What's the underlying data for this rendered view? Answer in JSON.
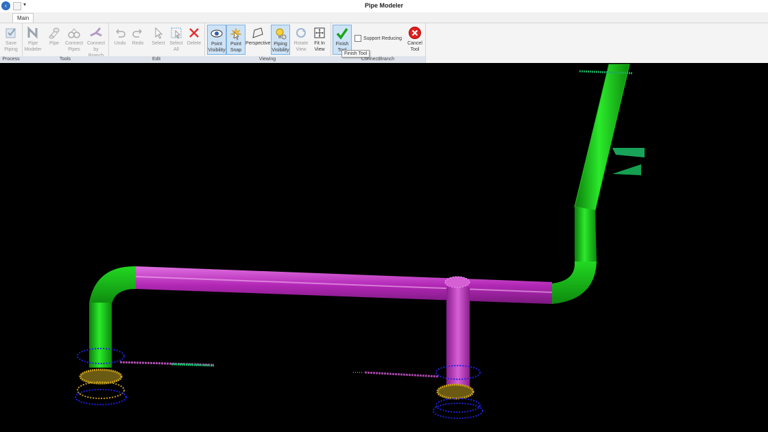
{
  "window": {
    "title": "Pipe Modeler"
  },
  "tabs": [
    {
      "label": "Main"
    }
  ],
  "groups": {
    "process": "Process",
    "tools": "Tools",
    "edit": "Edit",
    "viewing": "Viewing",
    "connect_branch": "ConnectBranch"
  },
  "buttons": {
    "save_piping": [
      "Save",
      "Piping"
    ],
    "pipe_modeler": [
      "Pipe",
      "Modeler"
    ],
    "pipe": [
      "Pipe",
      ""
    ],
    "connect_pipes": [
      "Connect",
      "Pipes"
    ],
    "connect_by_branch": [
      "Connect",
      "by Branch"
    ],
    "undo": [
      "Undo",
      ""
    ],
    "redo": [
      "Redo",
      ""
    ],
    "select": [
      "Select",
      ""
    ],
    "select_all": [
      "Select",
      "All"
    ],
    "delete": [
      "Delete",
      ""
    ],
    "point_visibility": [
      "Point",
      "Visibility"
    ],
    "point_snap": [
      "Point",
      "Snap"
    ],
    "perspective": [
      "Perspective",
      ""
    ],
    "piping_visibility": [
      "Piping",
      "Visibility"
    ],
    "rotate_view": [
      "Rotate",
      "View"
    ],
    "fit_in_view": [
      "Fit In",
      "View"
    ],
    "finish_tool": [
      "Finish",
      "Tool"
    ],
    "cancel_tool": [
      "Cancel",
      "Tool"
    ]
  },
  "support_reducing": {
    "label": "Support Reducing",
    "checked": false
  },
  "tooltip": "Finish Tool",
  "colors": {
    "pipe_green": "#18d018",
    "pipe_magenta": "#c82fc8",
    "support_blue": "#2222dd",
    "support_yellow": "#c8a020"
  }
}
